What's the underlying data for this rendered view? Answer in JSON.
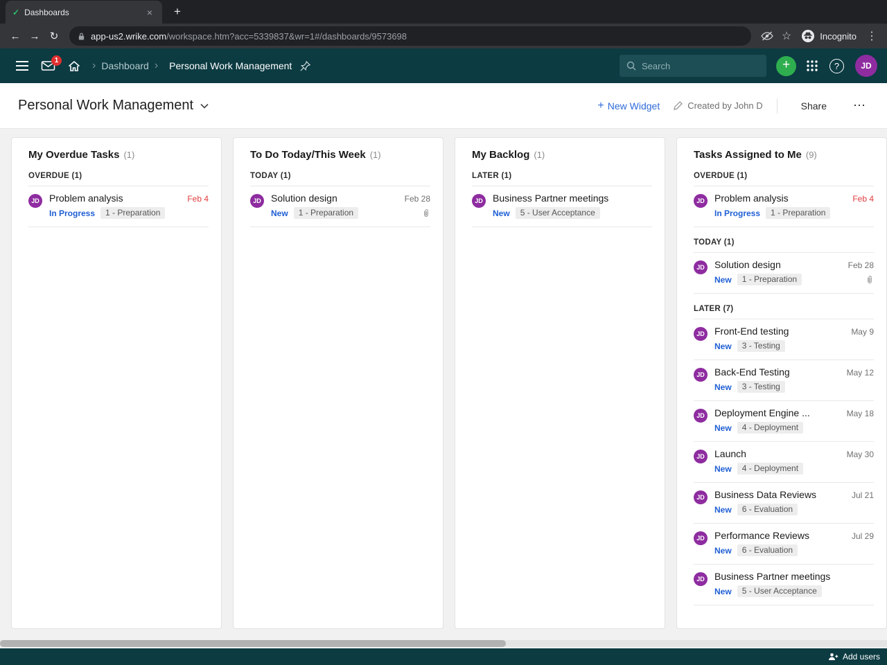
{
  "colors": {
    "header_teal": "#0c3b42",
    "accent_green": "#2fae4f",
    "accent_blue": "#2f6bd8",
    "status_blue": "#1f5fd5",
    "overdue_red": "#e23b3e",
    "avatar_purple": "#8e2ca0"
  },
  "icons": {
    "plus": "+",
    "more": "⋯",
    "kebab": "⋮",
    "back": "←",
    "forward": "→",
    "reload": "↻",
    "close": "×",
    "star": "☆",
    "chevron": "›",
    "check": "✓",
    "help": "?"
  },
  "browser": {
    "tab_title": "Dashboards",
    "url_domain": "app-us2.wrike.com",
    "url_path": "/workspace.htm?acc=5339837&wr=1#/dashboards/9573698",
    "incognito_label": "Incognito"
  },
  "app_header": {
    "inbox_badge": "1",
    "breadcrumb_section": "Dashboard",
    "breadcrumb_page": "Personal Work Management",
    "search_placeholder": "Search",
    "avatar_initials": "JD"
  },
  "title_bar": {
    "title": "Personal Work Management",
    "new_widget_label": "New Widget",
    "created_by": "Created by John D",
    "share_label": "Share"
  },
  "widgets": [
    {
      "title": "My Overdue Tasks",
      "count": "(1)",
      "sections": [
        {
          "label": "OVERDUE (1)",
          "tasks": [
            {
              "avatar": "JD",
              "title": "Problem analysis",
              "date": "Feb 4",
              "overdue": true,
              "status": "In Progress",
              "stage": "1 - Preparation"
            }
          ]
        }
      ]
    },
    {
      "title": "To Do Today/This Week",
      "count": "(1)",
      "sections": [
        {
          "label": "TODAY (1)",
          "tasks": [
            {
              "avatar": "JD",
              "title": "Solution design",
              "date": "Feb 28",
              "status": "New",
              "stage": "1 - Preparation",
              "attachment": true
            }
          ]
        }
      ]
    },
    {
      "title": "My Backlog",
      "count": "(1)",
      "sections": [
        {
          "label": "LATER (1)",
          "tasks": [
            {
              "avatar": "JD",
              "title": "Business Partner meetings",
              "status": "New",
              "stage": "5 - User Acceptance"
            }
          ]
        }
      ]
    },
    {
      "title": "Tasks Assigned to Me",
      "count": "(9)",
      "sections": [
        {
          "label": "OVERDUE (1)",
          "tasks": [
            {
              "avatar": "JD",
              "title": "Problem analysis",
              "date": "Feb 4",
              "overdue": true,
              "status": "In Progress",
              "stage": "1 - Preparation"
            }
          ]
        },
        {
          "label": "TODAY (1)",
          "tasks": [
            {
              "avatar": "JD",
              "title": "Solution design",
              "date": "Feb 28",
              "status": "New",
              "stage": "1 - Preparation",
              "attachment": true
            }
          ]
        },
        {
          "label": "LATER (7)",
          "tasks": [
            {
              "avatar": "JD",
              "title": "Front-End testing",
              "date": "May 9",
              "status": "New",
              "stage": "3 - Testing"
            },
            {
              "avatar": "JD",
              "title": "Back-End Testing",
              "date": "May 12",
              "status": "New",
              "stage": "3 - Testing"
            },
            {
              "avatar": "JD",
              "title": "Deployment Engine ...",
              "date": "May 18",
              "status": "New",
              "stage": "4 - Deployment"
            },
            {
              "avatar": "JD",
              "title": "Launch",
              "date": "May 30",
              "status": "New",
              "stage": "4 - Deployment"
            },
            {
              "avatar": "JD",
              "title": "Business Data Reviews",
              "date": "Jul 21",
              "status": "New",
              "stage": "6 - Evaluation"
            },
            {
              "avatar": "JD",
              "title": "Performance Reviews",
              "date": "Jul 29",
              "status": "New",
              "stage": "6 - Evaluation"
            },
            {
              "avatar": "JD",
              "title": "Business Partner meetings",
              "status": "New",
              "stage": "5 - User Acceptance"
            }
          ]
        }
      ]
    }
  ],
  "footer": {
    "add_users_label": "Add users"
  }
}
